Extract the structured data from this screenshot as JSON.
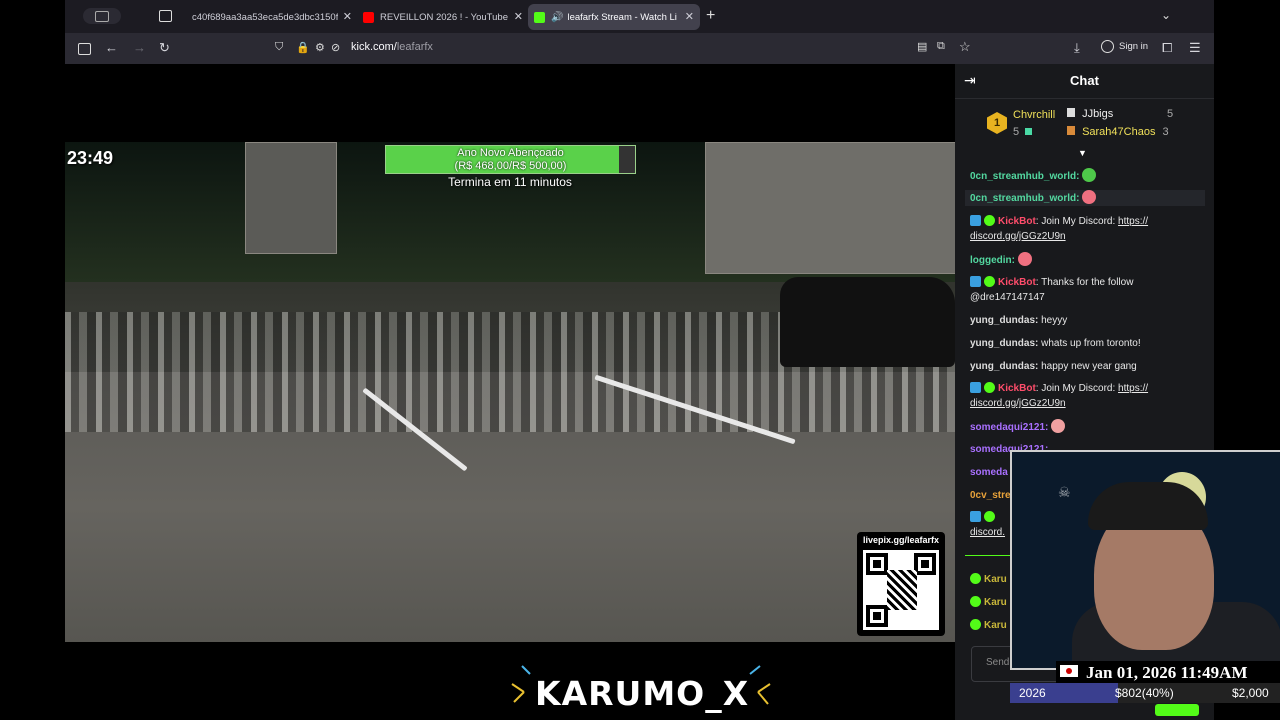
{
  "browser": {
    "tabs": [
      {
        "title": "c40f689aa3aa53eca5de3dbc3150f",
        "color": "#3c3c44"
      },
      {
        "title": "REVEILLON 2026 ! - YouTube",
        "color": "#ff0000"
      },
      {
        "title": "leafarfx Stream - Watch Liv",
        "color": "#53fc18"
      }
    ],
    "url_domain": "kick.com/",
    "url_path": "leafarfx",
    "sign_in_label": "Sign in"
  },
  "player": {
    "timestamp": "23:49",
    "donation_goal_title": "Ano Novo Abençoado",
    "donation_goal_amount": "(R$ 468,00/R$ 500,00)",
    "donation_goal_fraction": 0.936,
    "ends_in": "Termina em 11 minutos",
    "qr_label": "livepix.gg/leafarfx",
    "logo_text": "KARUMO_X"
  },
  "chat": {
    "title": "Chat",
    "top_gifters": [
      {
        "name": "Chvrchill",
        "count": "5",
        "rank": "1"
      },
      {
        "name": "JJbigs",
        "count": "5"
      },
      {
        "name": "Sarah47Chaos",
        "count": "3"
      }
    ],
    "messages": [
      {
        "user": "0cn_streamhub_world:",
        "text": ""
      },
      {
        "user": "0cn_streamhub_world:",
        "text": ""
      },
      {
        "user": "KickBot",
        "text": ": Join My Discord: ",
        "link1": "https://",
        "link2": "discord.gg/jGGz2U9n"
      },
      {
        "user": "loggedin:",
        "text": ""
      },
      {
        "user": "KickBot",
        "text": ": Thanks for the follow",
        "text2": "@dre147147147"
      },
      {
        "user": "yung_dundas:",
        "text": " heyyy"
      },
      {
        "user": "yung_dundas:",
        "text": " whats up from toronto!"
      },
      {
        "user": "yung_dundas:",
        "text": " happy new year gang"
      },
      {
        "user": "KickBot",
        "text": ": Join My Discord: ",
        "link1": "https://",
        "link2": "discord.gg/jGGz2U9n"
      },
      {
        "user": "somedaqui2121:",
        "text": ""
      },
      {
        "user": "somedaqui2121:",
        "text": ""
      },
      {
        "user": "someda",
        "text": ""
      },
      {
        "user": "0cv_stre",
        "text": ""
      },
      {
        "user": "",
        "text": "",
        "link2": "discord."
      },
      {
        "user": "Karu",
        "text": ""
      },
      {
        "user": "Karu",
        "text": ""
      },
      {
        "user": "Karu",
        "text": ""
      }
    ],
    "send_placeholder": "Send"
  },
  "overlay": {
    "date": "Jan 01, 2026 11:49AM",
    "goal_left": "2026",
    "goal_mid": "$802(40%)",
    "goal_right": "$2,000",
    "goal_fraction": 0.4
  }
}
